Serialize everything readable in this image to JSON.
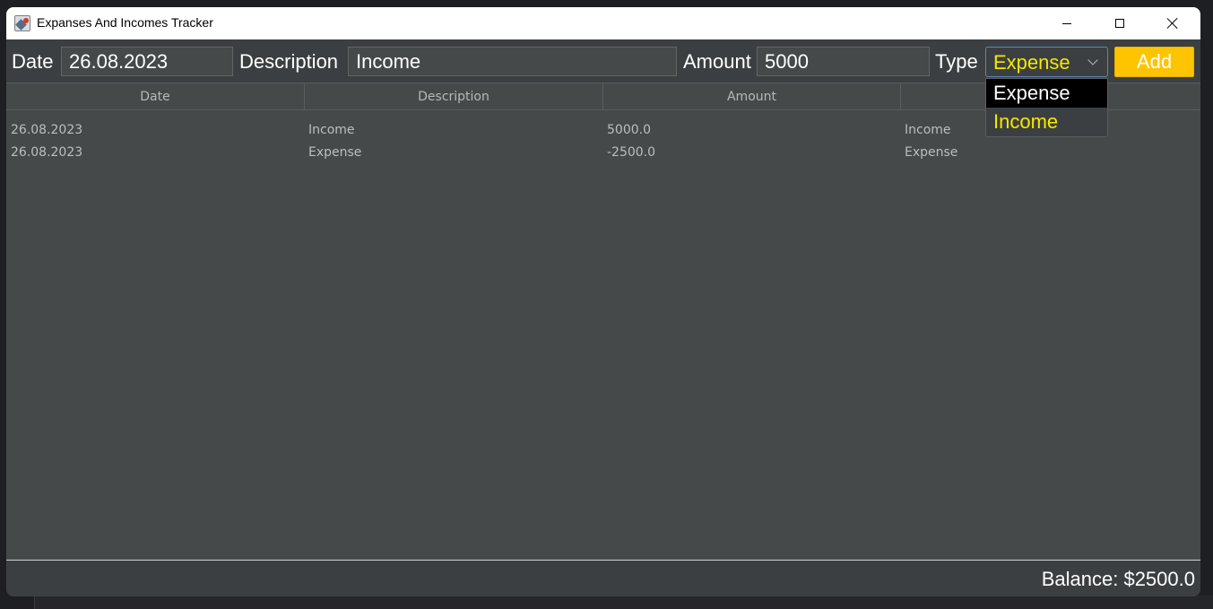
{
  "window": {
    "title": "Expanses And Incomes Tracker",
    "app_icon": "java-app-icon",
    "controls": [
      "minimize-icon",
      "maximize-icon",
      "close-icon"
    ]
  },
  "form": {
    "date_label": "Date",
    "date_value": "26.08.2023",
    "description_label": "Description",
    "description_value": "Income",
    "amount_label": "Amount",
    "amount_value": "5000",
    "type_label": "Type",
    "type_selected": "Expense",
    "type_options": [
      "Expense",
      "Income"
    ],
    "add_label": "Add"
  },
  "table": {
    "columns": [
      "Date",
      "Description",
      "Amount",
      ""
    ],
    "rows": [
      [
        "26.08.2023",
        "Income",
        "5000.0",
        "Income"
      ],
      [
        "26.08.2023",
        "Expense",
        "-2500.0",
        "Expense"
      ]
    ]
  },
  "footer": {
    "balance": "Balance: $2500.0"
  },
  "colors": {
    "background": "#3c3f41",
    "table_bg": "#45494a",
    "accent_yellow": "#ffc400",
    "select_text": "#f5e800",
    "titlebar": "#ffffff"
  }
}
